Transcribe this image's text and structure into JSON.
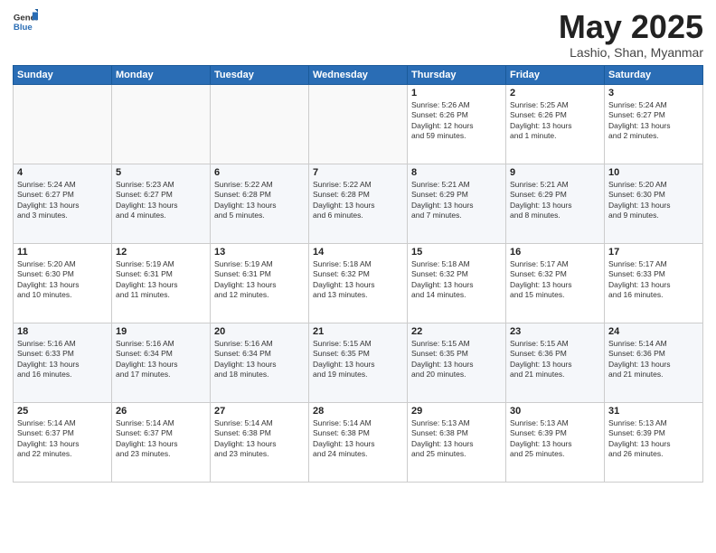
{
  "header": {
    "logo_general": "General",
    "logo_blue": "Blue",
    "title": "May 2025",
    "subtitle": "Lashio, Shan, Myanmar"
  },
  "weekdays": [
    "Sunday",
    "Monday",
    "Tuesday",
    "Wednesday",
    "Thursday",
    "Friday",
    "Saturday"
  ],
  "weeks": [
    [
      {
        "day": "",
        "info": ""
      },
      {
        "day": "",
        "info": ""
      },
      {
        "day": "",
        "info": ""
      },
      {
        "day": "",
        "info": ""
      },
      {
        "day": "1",
        "info": "Sunrise: 5:26 AM\nSunset: 6:26 PM\nDaylight: 12 hours\nand 59 minutes."
      },
      {
        "day": "2",
        "info": "Sunrise: 5:25 AM\nSunset: 6:26 PM\nDaylight: 13 hours\nand 1 minute."
      },
      {
        "day": "3",
        "info": "Sunrise: 5:24 AM\nSunset: 6:27 PM\nDaylight: 13 hours\nand 2 minutes."
      }
    ],
    [
      {
        "day": "4",
        "info": "Sunrise: 5:24 AM\nSunset: 6:27 PM\nDaylight: 13 hours\nand 3 minutes."
      },
      {
        "day": "5",
        "info": "Sunrise: 5:23 AM\nSunset: 6:27 PM\nDaylight: 13 hours\nand 4 minutes."
      },
      {
        "day": "6",
        "info": "Sunrise: 5:22 AM\nSunset: 6:28 PM\nDaylight: 13 hours\nand 5 minutes."
      },
      {
        "day": "7",
        "info": "Sunrise: 5:22 AM\nSunset: 6:28 PM\nDaylight: 13 hours\nand 6 minutes."
      },
      {
        "day": "8",
        "info": "Sunrise: 5:21 AM\nSunset: 6:29 PM\nDaylight: 13 hours\nand 7 minutes."
      },
      {
        "day": "9",
        "info": "Sunrise: 5:21 AM\nSunset: 6:29 PM\nDaylight: 13 hours\nand 8 minutes."
      },
      {
        "day": "10",
        "info": "Sunrise: 5:20 AM\nSunset: 6:30 PM\nDaylight: 13 hours\nand 9 minutes."
      }
    ],
    [
      {
        "day": "11",
        "info": "Sunrise: 5:20 AM\nSunset: 6:30 PM\nDaylight: 13 hours\nand 10 minutes."
      },
      {
        "day": "12",
        "info": "Sunrise: 5:19 AM\nSunset: 6:31 PM\nDaylight: 13 hours\nand 11 minutes."
      },
      {
        "day": "13",
        "info": "Sunrise: 5:19 AM\nSunset: 6:31 PM\nDaylight: 13 hours\nand 12 minutes."
      },
      {
        "day": "14",
        "info": "Sunrise: 5:18 AM\nSunset: 6:32 PM\nDaylight: 13 hours\nand 13 minutes."
      },
      {
        "day": "15",
        "info": "Sunrise: 5:18 AM\nSunset: 6:32 PM\nDaylight: 13 hours\nand 14 minutes."
      },
      {
        "day": "16",
        "info": "Sunrise: 5:17 AM\nSunset: 6:32 PM\nDaylight: 13 hours\nand 15 minutes."
      },
      {
        "day": "17",
        "info": "Sunrise: 5:17 AM\nSunset: 6:33 PM\nDaylight: 13 hours\nand 16 minutes."
      }
    ],
    [
      {
        "day": "18",
        "info": "Sunrise: 5:16 AM\nSunset: 6:33 PM\nDaylight: 13 hours\nand 16 minutes."
      },
      {
        "day": "19",
        "info": "Sunrise: 5:16 AM\nSunset: 6:34 PM\nDaylight: 13 hours\nand 17 minutes."
      },
      {
        "day": "20",
        "info": "Sunrise: 5:16 AM\nSunset: 6:34 PM\nDaylight: 13 hours\nand 18 minutes."
      },
      {
        "day": "21",
        "info": "Sunrise: 5:15 AM\nSunset: 6:35 PM\nDaylight: 13 hours\nand 19 minutes."
      },
      {
        "day": "22",
        "info": "Sunrise: 5:15 AM\nSunset: 6:35 PM\nDaylight: 13 hours\nand 20 minutes."
      },
      {
        "day": "23",
        "info": "Sunrise: 5:15 AM\nSunset: 6:36 PM\nDaylight: 13 hours\nand 21 minutes."
      },
      {
        "day": "24",
        "info": "Sunrise: 5:14 AM\nSunset: 6:36 PM\nDaylight: 13 hours\nand 21 minutes."
      }
    ],
    [
      {
        "day": "25",
        "info": "Sunrise: 5:14 AM\nSunset: 6:37 PM\nDaylight: 13 hours\nand 22 minutes."
      },
      {
        "day": "26",
        "info": "Sunrise: 5:14 AM\nSunset: 6:37 PM\nDaylight: 13 hours\nand 23 minutes."
      },
      {
        "day": "27",
        "info": "Sunrise: 5:14 AM\nSunset: 6:38 PM\nDaylight: 13 hours\nand 23 minutes."
      },
      {
        "day": "28",
        "info": "Sunrise: 5:14 AM\nSunset: 6:38 PM\nDaylight: 13 hours\nand 24 minutes."
      },
      {
        "day": "29",
        "info": "Sunrise: 5:13 AM\nSunset: 6:38 PM\nDaylight: 13 hours\nand 25 minutes."
      },
      {
        "day": "30",
        "info": "Sunrise: 5:13 AM\nSunset: 6:39 PM\nDaylight: 13 hours\nand 25 minutes."
      },
      {
        "day": "31",
        "info": "Sunrise: 5:13 AM\nSunset: 6:39 PM\nDaylight: 13 hours\nand 26 minutes."
      }
    ]
  ]
}
